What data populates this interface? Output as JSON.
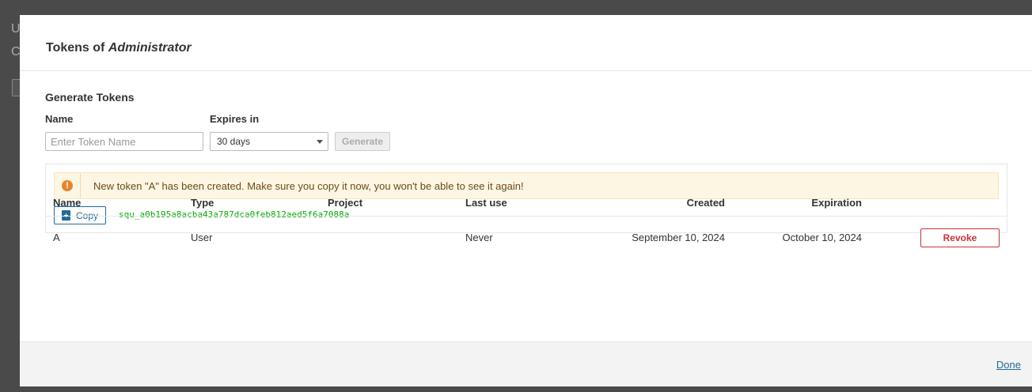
{
  "background": {
    "line1": "U",
    "line2": "C"
  },
  "modal": {
    "title_prefix": "Tokens of ",
    "title_user": "Administrator"
  },
  "generate": {
    "section_title": "Generate Tokens",
    "name_label": "Name",
    "name_placeholder": "Enter Token Name",
    "expires_label": "Expires in",
    "expires_value": "30 days",
    "generate_button": "Generate"
  },
  "alert": {
    "icon": "exclamation-icon",
    "text": "New token \"A\" has been created. Make sure you copy it now, you won't be able to see it again!"
  },
  "token": {
    "copy_label": "Copy",
    "value": "squ_a0b195a8acba43a787dca0feb812aed5f6a7088a"
  },
  "table": {
    "headers": {
      "name": "Name",
      "type": "Type",
      "project": "Project",
      "last_use": "Last use",
      "created": "Created",
      "expiration": "Expiration"
    },
    "rows": [
      {
        "name": "A",
        "type": "User",
        "project": "",
        "last_use": "Never",
        "created": "September 10, 2024",
        "expiration": "October 10, 2024",
        "revoke": "Revoke"
      }
    ]
  },
  "footer": {
    "done": "Done"
  },
  "colors": {
    "accent": "#236a97",
    "danger": "#d02f3a",
    "warning": "#e8852a",
    "token_text": "#00aa00"
  }
}
